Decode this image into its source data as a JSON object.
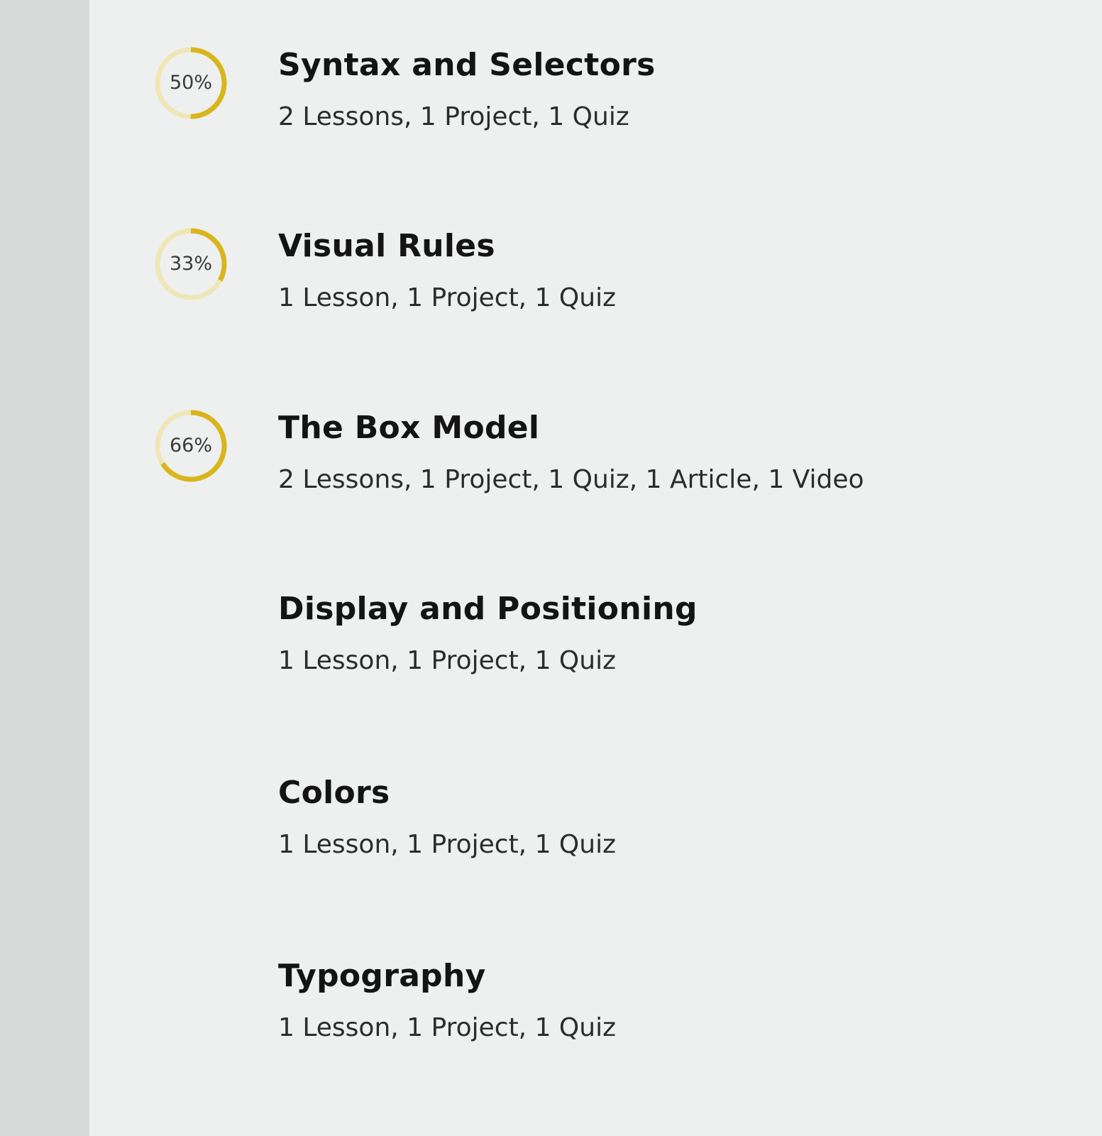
{
  "colors": {
    "ring_progress": "#d9b51c",
    "ring_track": "#efe6b8"
  },
  "modules": [
    {
      "title": "Syntax and Selectors",
      "meta": "2 Lessons, 1 Project, 1 Quiz",
      "progress_label": "50%",
      "progress": 0.5
    },
    {
      "title": "Visual Rules",
      "meta": "1 Lesson, 1 Project, 1 Quiz",
      "progress_label": "33%",
      "progress": 0.33
    },
    {
      "title": "The Box Model",
      "meta": "2 Lessons, 1 Project, 1 Quiz, 1 Article, 1 Video",
      "progress_label": "66%",
      "progress": 0.66
    },
    {
      "title": "Display and Positioning",
      "meta": "1 Lesson, 1 Project, 1 Quiz"
    },
    {
      "title": "Colors",
      "meta": "1 Lesson, 1 Project, 1 Quiz"
    },
    {
      "title": "Typography",
      "meta": "1 Lesson, 1 Project, 1 Quiz"
    }
  ]
}
